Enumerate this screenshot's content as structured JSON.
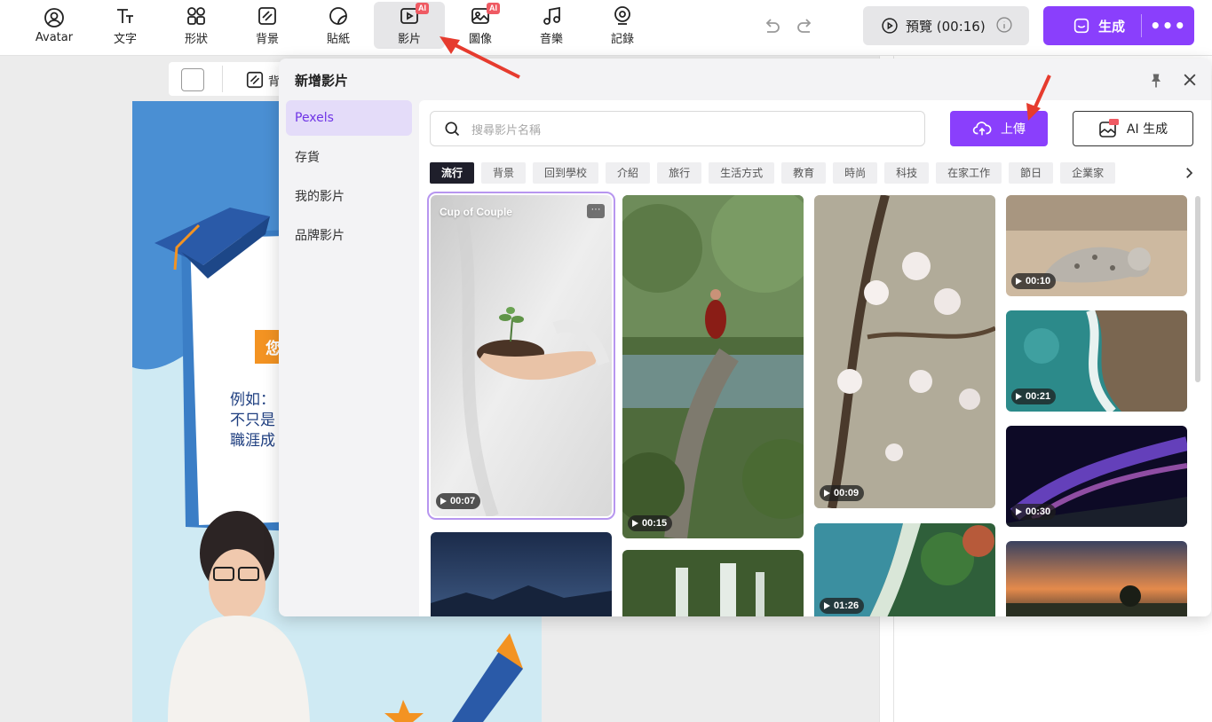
{
  "toolbar": {
    "tools": [
      {
        "label": "Avatar",
        "icon": "avatar-icon"
      },
      {
        "label": "文字",
        "icon": "text-icon"
      },
      {
        "label": "形狀",
        "icon": "shapes-icon"
      },
      {
        "label": "背景",
        "icon": "background-icon"
      },
      {
        "label": "貼紙",
        "icon": "sticker-icon"
      },
      {
        "label": "影片",
        "icon": "video-icon",
        "badge": "AI"
      },
      {
        "label": "圖像",
        "icon": "image-icon",
        "badge": "AI"
      },
      {
        "label": "音樂",
        "icon": "music-icon"
      },
      {
        "label": "記錄",
        "icon": "record-icon"
      }
    ],
    "preview_label": "預覽 (00:16)",
    "generate_label": "生成",
    "more_label": "•••"
  },
  "subbar": {
    "background_label": "背"
  },
  "modal": {
    "title": "新增影片",
    "sidebar": [
      "Pexels",
      "存貨",
      "我的影片",
      "品牌影片"
    ],
    "search_placeholder": "搜尋影片名稱",
    "upload_label": "上傳",
    "ai_generate_label": "AI 生成",
    "ai_badge": "AI",
    "tags": [
      "流行",
      "背景",
      "回到學校",
      "介紹",
      "旅行",
      "生活方式",
      "教育",
      "時尚",
      "科技",
      "在家工作",
      "節日",
      "企業家"
    ],
    "videos": [
      {
        "title": "Cup of Couple",
        "duration": "00:07"
      },
      {
        "duration": "00:15"
      },
      {
        "duration": "00:09"
      },
      {
        "duration": "00:10"
      },
      {
        "duration": "00:21"
      },
      {
        "duration": "00:30"
      },
      {
        "duration": "01:26"
      }
    ]
  },
  "slide": {
    "orange_text": "您",
    "lines": [
      "例如：",
      "不只是",
      "職涯成"
    ]
  },
  "colors": {
    "accent": "#8a3ffc",
    "badge": "#ef5a63"
  }
}
